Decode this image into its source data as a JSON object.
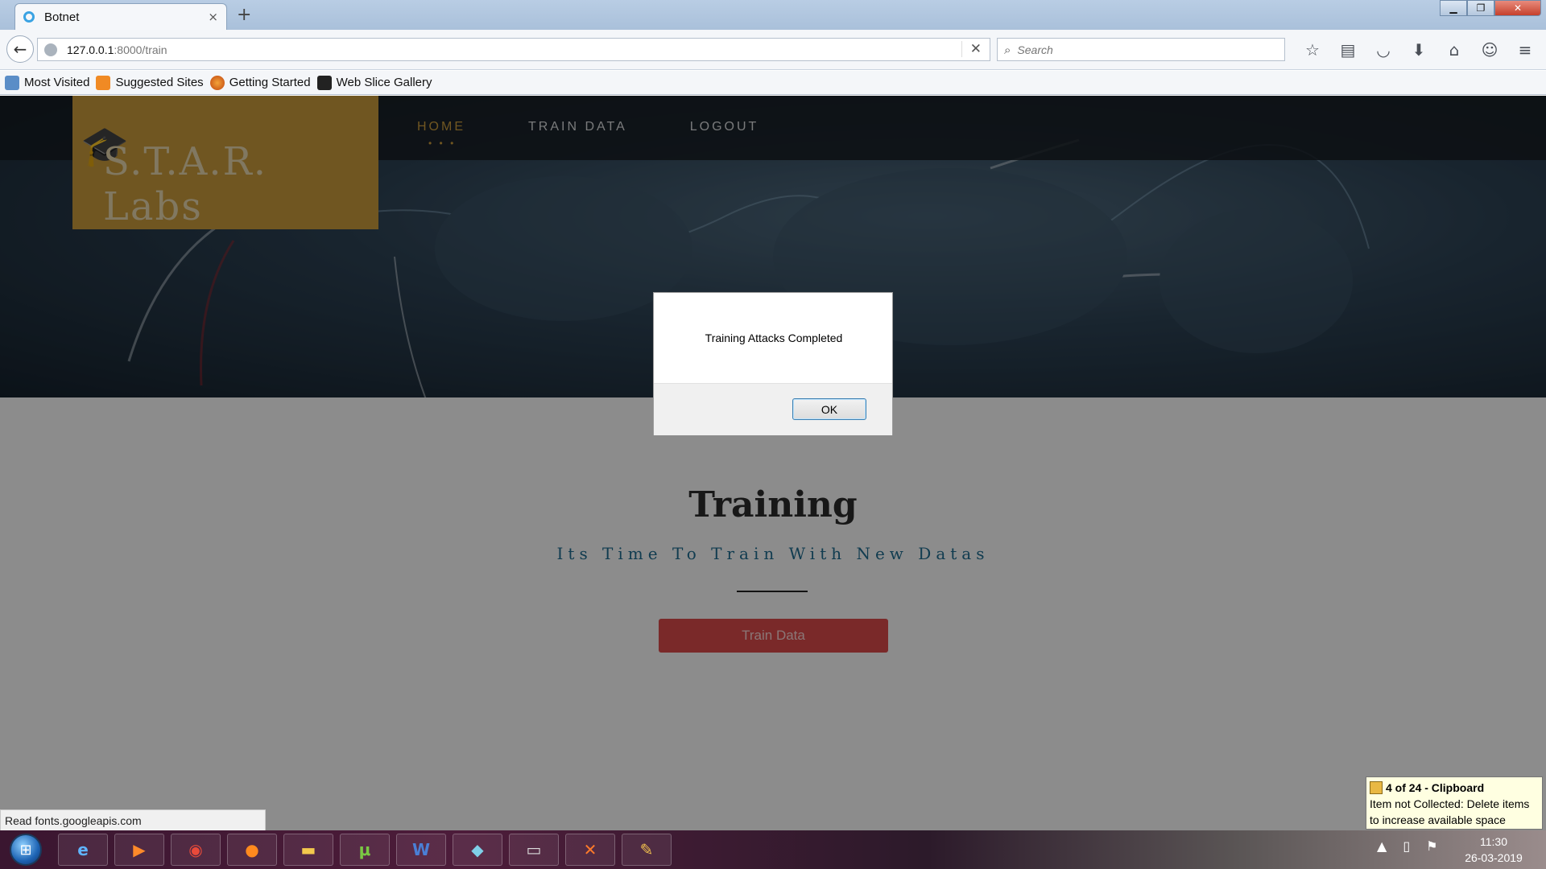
{
  "browser": {
    "tab_title": "Botnet",
    "tab_close": "×",
    "new_tab": "+",
    "url_host": "127.0.0.1",
    "url_path": ":8000/train",
    "url_clear": "✕",
    "search_placeholder": "Search",
    "bookmarks": [
      "Most Visited",
      "Suggested Sites",
      "Getting Started",
      "Web Slice Gallery"
    ],
    "status_text": "Read fonts.googleapis.com"
  },
  "site": {
    "logo": "S.T.A.R. Labs",
    "nav": [
      "HOME",
      "TRAIN DATA",
      "LOGOUT"
    ],
    "nav_dots": "• • •",
    "heading": "Training",
    "subheading": "Its Time To Train With New Datas",
    "train_button": "Train Data"
  },
  "dialog": {
    "message": "Training Attacks Completed",
    "ok_label": "OK"
  },
  "notification": {
    "title": "4 of 24 - Clipboard",
    "line1": "Item not Collected: Delete items",
    "line2": "to increase available space"
  },
  "taskbar": {
    "time": "11:30",
    "date": "26-03-2019"
  },
  "colors": {
    "accent_gold": "#c89a3c",
    "button_red": "#d94a4a",
    "subheading_blue": "#1f6b8f"
  }
}
